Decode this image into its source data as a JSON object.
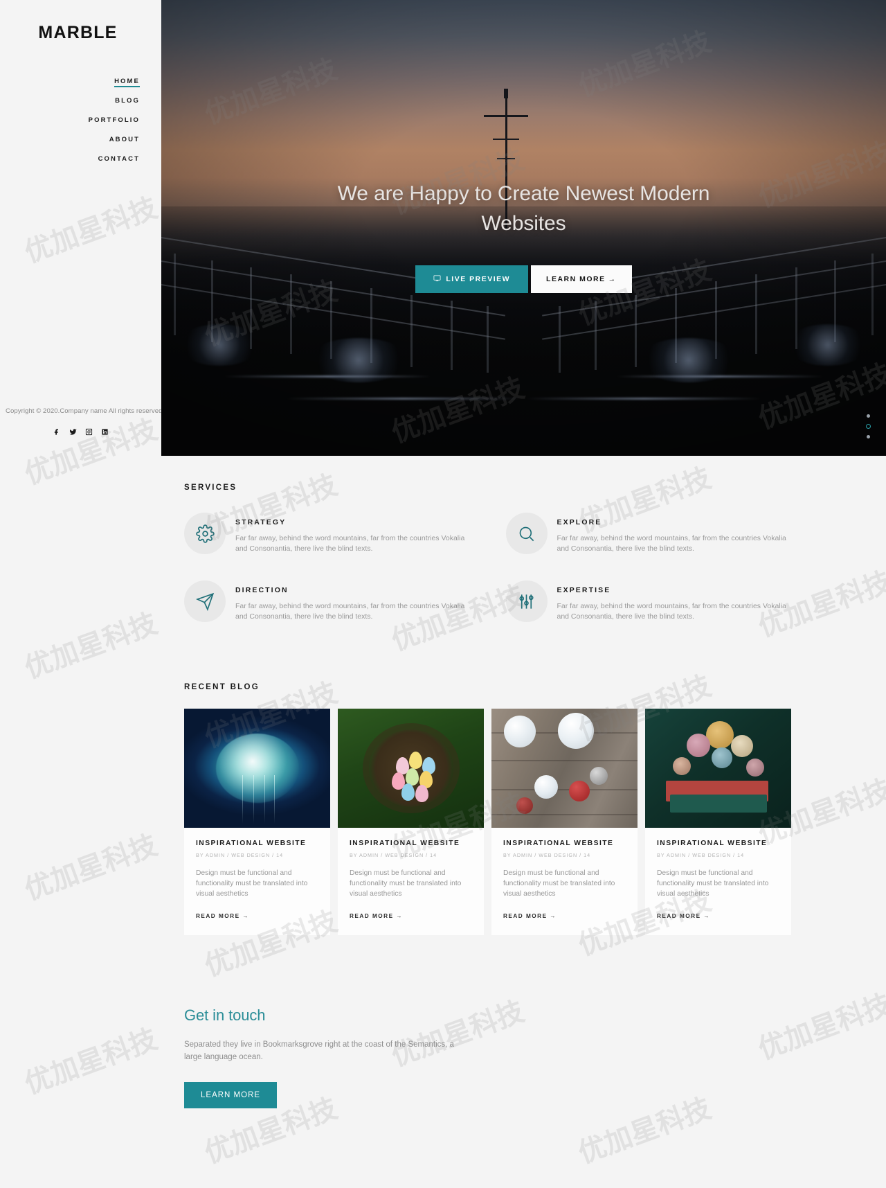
{
  "sidebar": {
    "brand": "MARBLE",
    "nav": [
      {
        "label": "HOME",
        "active": true
      },
      {
        "label": "BLOG",
        "active": false
      },
      {
        "label": "PORTFOLIO",
        "active": false
      },
      {
        "label": "ABOUT",
        "active": false
      },
      {
        "label": "CONTACT",
        "active": false
      }
    ],
    "copyright": "Copyright © 2020.Company name All rights reserved.",
    "socials": [
      {
        "name": "facebook-icon"
      },
      {
        "name": "twitter-icon"
      },
      {
        "name": "instagram-icon"
      },
      {
        "name": "linkedin-icon"
      }
    ]
  },
  "hero": {
    "title": "We are Happy to Create Newest Modern Websites",
    "primary_button": "LIVE PREVIEW",
    "secondary_button": "LEARN MORE",
    "secondary_arrow": "→",
    "slider_dots": 3,
    "active_dot": 2,
    "accent_color": "#1e8b95"
  },
  "services": {
    "title": "SERVICES",
    "items": [
      {
        "icon": "gear-icon",
        "heading": "STRATEGY",
        "text": "Far far away, behind the word mountains, far from the countries Vokalia and Consonantia, there live the blind texts."
      },
      {
        "icon": "magnifier-icon",
        "heading": "EXPLORE",
        "text": "Far far away, behind the word mountains, far from the countries Vokalia and Consonantia, there live the blind texts."
      },
      {
        "icon": "paper-plane-icon",
        "heading": "DIRECTION",
        "text": "Far far away, behind the word mountains, far from the countries Vokalia and Consonantia, there live the blind texts."
      },
      {
        "icon": "sliders-icon",
        "heading": "EXPERTISE",
        "text": "Far far away, behind the word mountains, far from the countries Vokalia and Consonantia, there live the blind texts."
      }
    ]
  },
  "blog": {
    "title": "RECENT BLOG",
    "posts": [
      {
        "title": "INSPIRATIONAL WEBSITE",
        "meta": "BY ADMIN / WEB DESIGN / 14",
        "excerpt": "Design must be functional and functionality must be translated into visual aesthetics",
        "read_more": "READ MORE →"
      },
      {
        "title": "INSPIRATIONAL WEBSITE",
        "meta": "BY ADMIN / WEB DESIGN / 14",
        "excerpt": "Design must be functional and functionality must be translated into visual aesthetics",
        "read_more": "READ MORE →"
      },
      {
        "title": "INSPIRATIONAL WEBSITE",
        "meta": "BY ADMIN / WEB DESIGN / 14",
        "excerpt": "Design must be functional and functionality must be translated into visual aesthetics",
        "read_more": "READ MORE →"
      },
      {
        "title": "INSPIRATIONAL WEBSITE",
        "meta": "BY ADMIN / WEB DESIGN / 14",
        "excerpt": "Design must be functional and functionality must be translated into visual aesthetics",
        "read_more": "READ MORE →"
      }
    ]
  },
  "touch": {
    "heading": "Get in touch",
    "text": "Separated they live in Bookmarksgrove right at the coast of the Semantics, a large language ocean.",
    "button": "LEARN MORE"
  },
  "watermark": {
    "text": "优加星科技"
  }
}
